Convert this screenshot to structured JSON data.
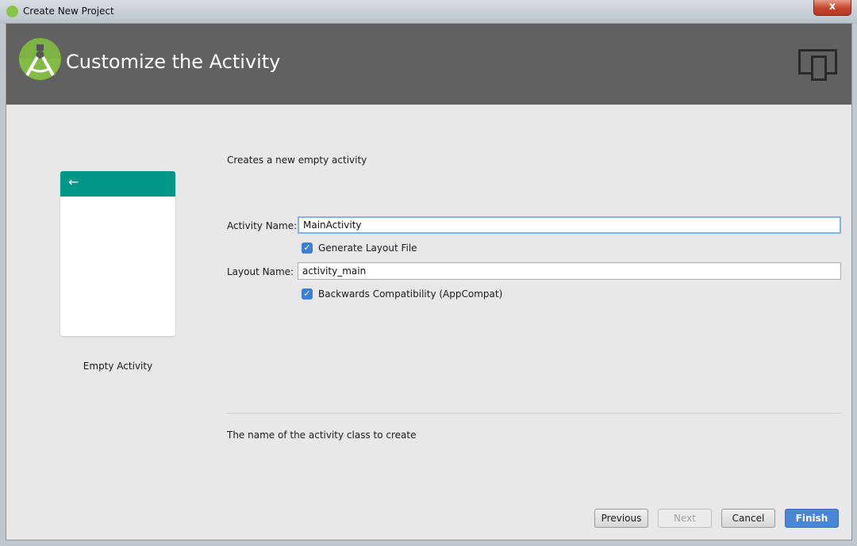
{
  "window": {
    "title": "Create New Project",
    "close_label": "x"
  },
  "header": {
    "title": "Customize the Activity",
    "logo": "android-studio-logo",
    "device_icon": "device-form-factor-icon"
  },
  "preview": {
    "back_arrow": "←",
    "caption": "Empty Activity",
    "toolbar_color": "#009688"
  },
  "form": {
    "description": "Creates a new empty activity",
    "activity_name_label": "Activity Name:",
    "activity_name_value": "MainActivity",
    "generate_layout_label": "Generate Layout File",
    "generate_layout_checked": true,
    "layout_name_label": "Layout Name:",
    "layout_name_value": "activity_main",
    "appcompat_label": "Backwards Compatibility (AppCompat)",
    "appcompat_checked": true,
    "help_text": "The name of the activity class to create"
  },
  "buttons": {
    "previous": "Previous",
    "next": "Next",
    "cancel": "Cancel",
    "finish": "Finish"
  },
  "colors": {
    "accent": "#4a86d8",
    "header": "#616161"
  }
}
